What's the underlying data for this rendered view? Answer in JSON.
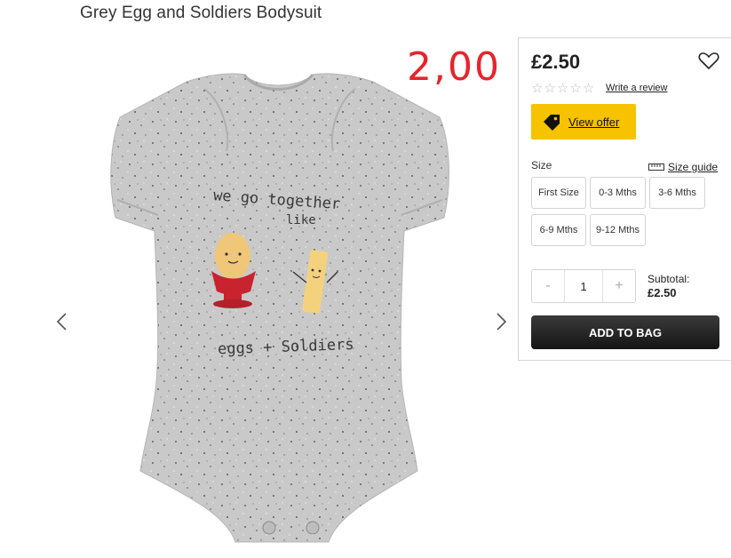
{
  "product": {
    "title": "Grey Egg and Soldiers Bodysuit",
    "print_line1": "we go together",
    "print_line2": "like",
    "print_line3": "eggs + Soldiers"
  },
  "annotation": {
    "new_price": "2,00"
  },
  "panel": {
    "price": "£2.50",
    "rating_stars": 0,
    "rating_max": 5,
    "write_review": "Write a review",
    "offer_label": "View offer",
    "size_label": "Size",
    "size_guide": "Size guide",
    "sizes": [
      "First Size",
      "0-3 Mths",
      "3-6 Mths",
      "6-9 Mths",
      "9-12 Mths"
    ],
    "quantity": "1",
    "qty_minus": "-",
    "qty_plus": "+",
    "subtotal_label": "Subtotal:",
    "subtotal_value": "£2.50",
    "add_to_bag": "ADD TO BAG"
  },
  "icons": {
    "prev": "chevron-left-icon",
    "next": "chevron-right-icon",
    "wishlist": "heart-icon",
    "offer": "tag-icon",
    "size_guide": "ruler-icon"
  },
  "colors": {
    "annotation_red": "#e8242c",
    "offer_yellow": "#f7c200",
    "button_dark": "#1a1a1a"
  }
}
